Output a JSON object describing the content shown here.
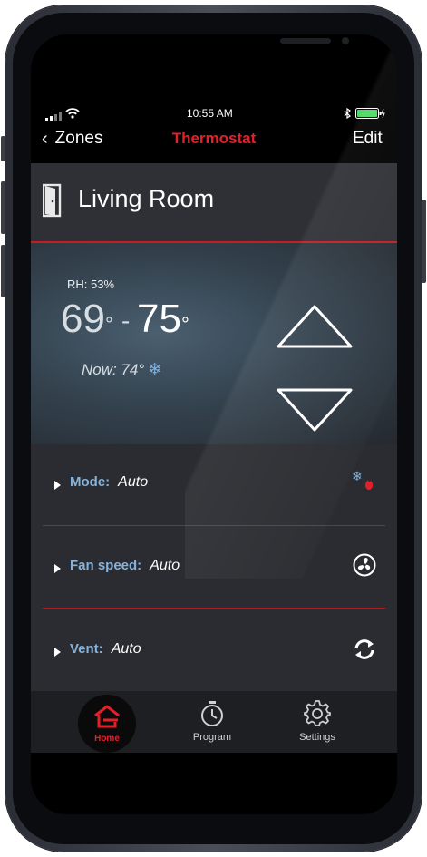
{
  "status_bar": {
    "time": "10:55 AM"
  },
  "nav": {
    "back_label": "Zones",
    "title": "Thermostat",
    "edit_label": "Edit"
  },
  "zone": {
    "name": "Living Room"
  },
  "climate": {
    "humidity": "RH: 53%",
    "setpoint_low": "69",
    "setpoint_separator": "-",
    "setpoint_high": "75",
    "degree_symbol": "°",
    "current": "Now: 74°"
  },
  "settings": {
    "mode": {
      "label": "Mode:",
      "value": "Auto"
    },
    "fan": {
      "label": "Fan speed:",
      "value": "Auto"
    },
    "vent": {
      "label": "Vent:",
      "value": "Auto"
    }
  },
  "tabs": [
    {
      "label": "Home",
      "icon": "home-icon",
      "active": true
    },
    {
      "label": "Program",
      "icon": "timer-icon",
      "active": false
    },
    {
      "label": "Settings",
      "icon": "gear-icon",
      "active": false
    }
  ],
  "colors": {
    "accent_red": "#e3202a",
    "label_blue": "#86b3dc",
    "snow_blue": "#7fb4e6"
  }
}
